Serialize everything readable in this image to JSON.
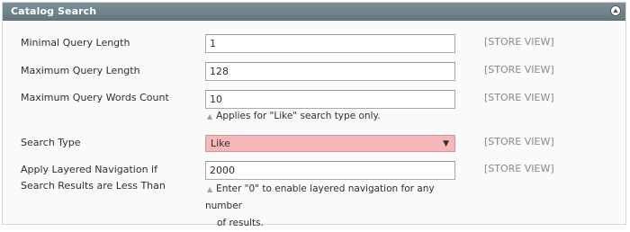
{
  "panel": {
    "title": "Catalog Search"
  },
  "fields": [
    {
      "label": "Minimal Query Length",
      "value": "1",
      "scope": "[STORE VIEW]"
    },
    {
      "label": "Maximum Query Length",
      "value": "128",
      "scope": "[STORE VIEW]"
    },
    {
      "label": "Maximum Query Words Count",
      "value": "10",
      "scope": "[STORE VIEW]",
      "note": "Applies for \"Like\" search type only."
    },
    {
      "label": "Search Type",
      "value": "Like",
      "scope": "[STORE VIEW]"
    },
    {
      "label_line1": "Apply Layered Navigation if",
      "label_line2": "Search Results are Less Than",
      "value": "2000",
      "scope": "[STORE VIEW]",
      "note_line1": "Enter \"0\" to enable layered navigation for any number",
      "note_line2": "of results."
    }
  ],
  "colors": {
    "header_bg": "#6f838a",
    "select_bg": "#f7b7b8",
    "scope_text": "#8a8a8a"
  }
}
